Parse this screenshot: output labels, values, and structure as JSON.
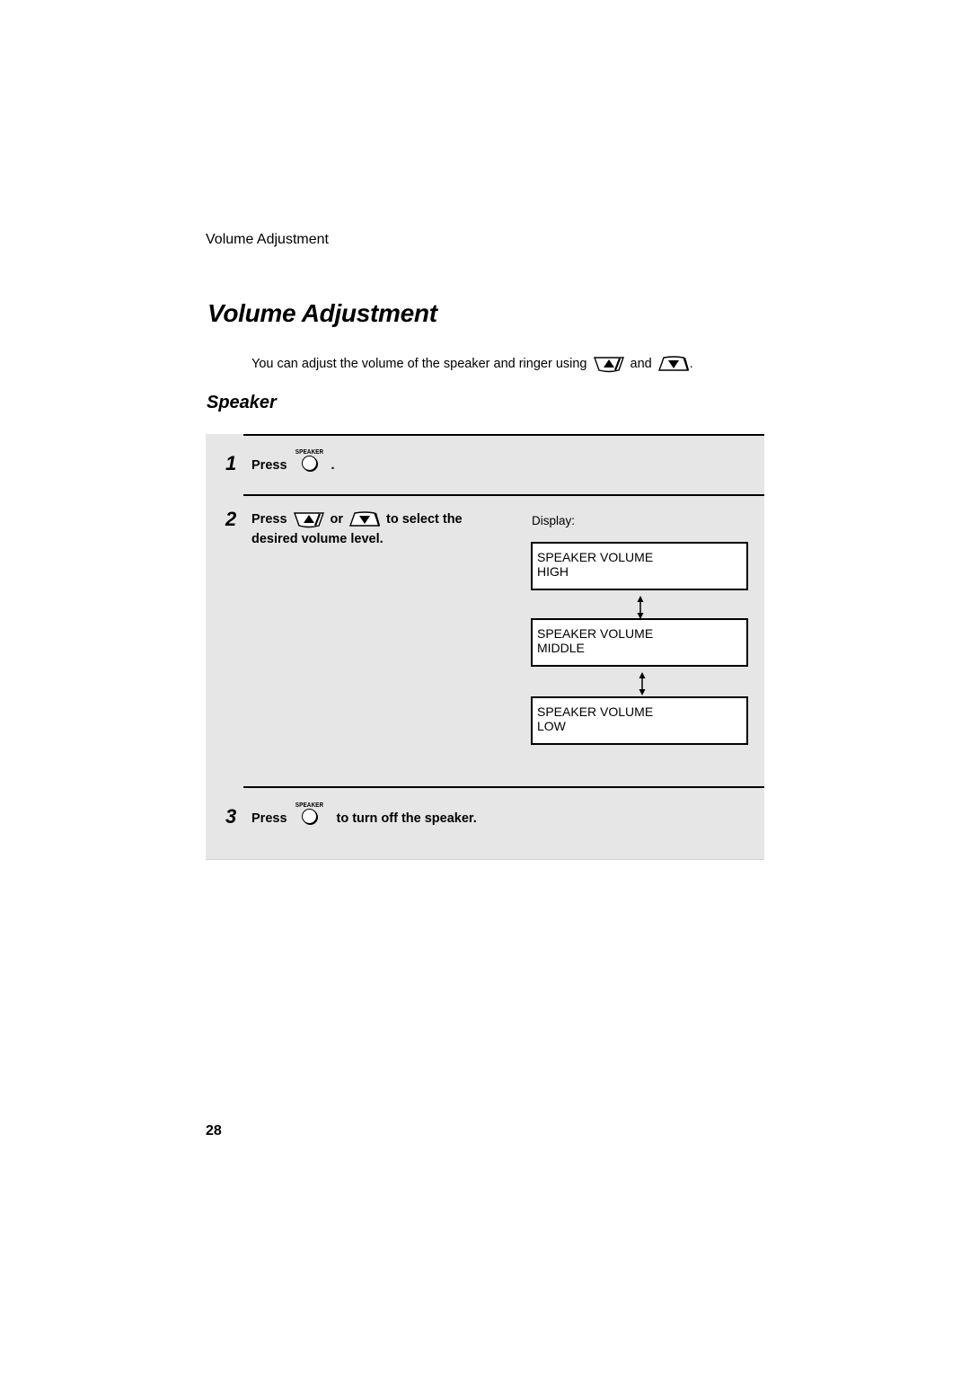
{
  "running_head": "Volume Adjustment",
  "title": "Volume Adjustment",
  "intro": {
    "text_before": "You can adjust the volume of the speaker and ringer using",
    "icon_up": "up-arrow-key-icon",
    "conjunction": "and",
    "icon_down": "down-arrow-key-icon",
    "text_after": "."
  },
  "section_title": "Speaker",
  "steps": [
    {
      "number": "1",
      "text_before": "Press",
      "key_label": "SPEAKER",
      "text_after": "."
    },
    {
      "number": "2",
      "text_before": "Press",
      "conjunction": "or",
      "text_after": "to select the",
      "text_line2": "desired volume level."
    },
    {
      "number": "3",
      "text_before": "Press",
      "key_label": "SPEAKER",
      "text_after": "to turn off the speaker."
    }
  ],
  "display": {
    "label": "Display:",
    "screens": [
      {
        "line1": "SPEAKER VOLUME",
        "line2": "HIGH"
      },
      {
        "line1": "SPEAKER VOLUME",
        "line2": "MIDDLE"
      },
      {
        "line1": "SPEAKER VOLUME",
        "line2": "LOW"
      }
    ]
  },
  "page_number": "28"
}
